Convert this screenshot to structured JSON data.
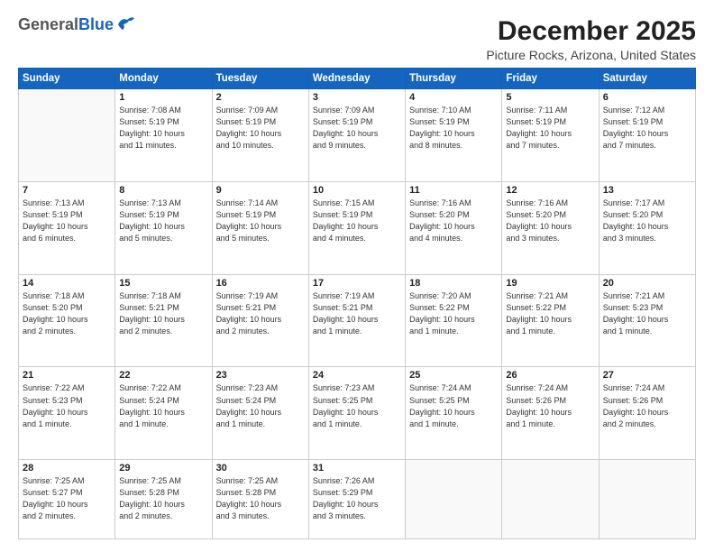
{
  "header": {
    "logo_general": "General",
    "logo_blue": "Blue",
    "month_title": "December 2025",
    "location": "Picture Rocks, Arizona, United States"
  },
  "days_of_week": [
    "Sunday",
    "Monday",
    "Tuesday",
    "Wednesday",
    "Thursday",
    "Friday",
    "Saturday"
  ],
  "weeks": [
    [
      {
        "day": "",
        "info": ""
      },
      {
        "day": "1",
        "info": "Sunrise: 7:08 AM\nSunset: 5:19 PM\nDaylight: 10 hours\nand 11 minutes."
      },
      {
        "day": "2",
        "info": "Sunrise: 7:09 AM\nSunset: 5:19 PM\nDaylight: 10 hours\nand 10 minutes."
      },
      {
        "day": "3",
        "info": "Sunrise: 7:09 AM\nSunset: 5:19 PM\nDaylight: 10 hours\nand 9 minutes."
      },
      {
        "day": "4",
        "info": "Sunrise: 7:10 AM\nSunset: 5:19 PM\nDaylight: 10 hours\nand 8 minutes."
      },
      {
        "day": "5",
        "info": "Sunrise: 7:11 AM\nSunset: 5:19 PM\nDaylight: 10 hours\nand 7 minutes."
      },
      {
        "day": "6",
        "info": "Sunrise: 7:12 AM\nSunset: 5:19 PM\nDaylight: 10 hours\nand 7 minutes."
      }
    ],
    [
      {
        "day": "7",
        "info": "Sunrise: 7:13 AM\nSunset: 5:19 PM\nDaylight: 10 hours\nand 6 minutes."
      },
      {
        "day": "8",
        "info": "Sunrise: 7:13 AM\nSunset: 5:19 PM\nDaylight: 10 hours\nand 5 minutes."
      },
      {
        "day": "9",
        "info": "Sunrise: 7:14 AM\nSunset: 5:19 PM\nDaylight: 10 hours\nand 5 minutes."
      },
      {
        "day": "10",
        "info": "Sunrise: 7:15 AM\nSunset: 5:19 PM\nDaylight: 10 hours\nand 4 minutes."
      },
      {
        "day": "11",
        "info": "Sunrise: 7:16 AM\nSunset: 5:20 PM\nDaylight: 10 hours\nand 4 minutes."
      },
      {
        "day": "12",
        "info": "Sunrise: 7:16 AM\nSunset: 5:20 PM\nDaylight: 10 hours\nand 3 minutes."
      },
      {
        "day": "13",
        "info": "Sunrise: 7:17 AM\nSunset: 5:20 PM\nDaylight: 10 hours\nand 3 minutes."
      }
    ],
    [
      {
        "day": "14",
        "info": "Sunrise: 7:18 AM\nSunset: 5:20 PM\nDaylight: 10 hours\nand 2 minutes."
      },
      {
        "day": "15",
        "info": "Sunrise: 7:18 AM\nSunset: 5:21 PM\nDaylight: 10 hours\nand 2 minutes."
      },
      {
        "day": "16",
        "info": "Sunrise: 7:19 AM\nSunset: 5:21 PM\nDaylight: 10 hours\nand 2 minutes."
      },
      {
        "day": "17",
        "info": "Sunrise: 7:19 AM\nSunset: 5:21 PM\nDaylight: 10 hours\nand 1 minute."
      },
      {
        "day": "18",
        "info": "Sunrise: 7:20 AM\nSunset: 5:22 PM\nDaylight: 10 hours\nand 1 minute."
      },
      {
        "day": "19",
        "info": "Sunrise: 7:21 AM\nSunset: 5:22 PM\nDaylight: 10 hours\nand 1 minute."
      },
      {
        "day": "20",
        "info": "Sunrise: 7:21 AM\nSunset: 5:23 PM\nDaylight: 10 hours\nand 1 minute."
      }
    ],
    [
      {
        "day": "21",
        "info": "Sunrise: 7:22 AM\nSunset: 5:23 PM\nDaylight: 10 hours\nand 1 minute."
      },
      {
        "day": "22",
        "info": "Sunrise: 7:22 AM\nSunset: 5:24 PM\nDaylight: 10 hours\nand 1 minute."
      },
      {
        "day": "23",
        "info": "Sunrise: 7:23 AM\nSunset: 5:24 PM\nDaylight: 10 hours\nand 1 minute."
      },
      {
        "day": "24",
        "info": "Sunrise: 7:23 AM\nSunset: 5:25 PM\nDaylight: 10 hours\nand 1 minute."
      },
      {
        "day": "25",
        "info": "Sunrise: 7:24 AM\nSunset: 5:25 PM\nDaylight: 10 hours\nand 1 minute."
      },
      {
        "day": "26",
        "info": "Sunrise: 7:24 AM\nSunset: 5:26 PM\nDaylight: 10 hours\nand 1 minute."
      },
      {
        "day": "27",
        "info": "Sunrise: 7:24 AM\nSunset: 5:26 PM\nDaylight: 10 hours\nand 2 minutes."
      }
    ],
    [
      {
        "day": "28",
        "info": "Sunrise: 7:25 AM\nSunset: 5:27 PM\nDaylight: 10 hours\nand 2 minutes."
      },
      {
        "day": "29",
        "info": "Sunrise: 7:25 AM\nSunset: 5:28 PM\nDaylight: 10 hours\nand 2 minutes."
      },
      {
        "day": "30",
        "info": "Sunrise: 7:25 AM\nSunset: 5:28 PM\nDaylight: 10 hours\nand 3 minutes."
      },
      {
        "day": "31",
        "info": "Sunrise: 7:26 AM\nSunset: 5:29 PM\nDaylight: 10 hours\nand 3 minutes."
      },
      {
        "day": "",
        "info": ""
      },
      {
        "day": "",
        "info": ""
      },
      {
        "day": "",
        "info": ""
      }
    ]
  ]
}
